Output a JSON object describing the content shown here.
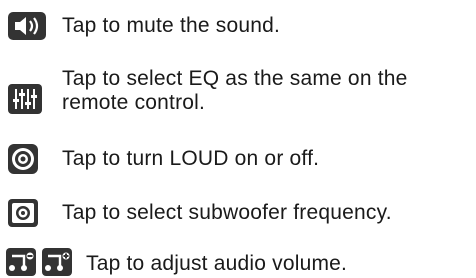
{
  "items": [
    {
      "icon": "speaker-icon",
      "text": "Tap to mute the sound."
    },
    {
      "icon": "equalizer-icon",
      "text_line1": "Tap to select EQ as the same on the",
      "text_line2": "remote control."
    },
    {
      "icon": "loud-icon",
      "text": "Tap to turn LOUD on or off."
    },
    {
      "icon": "subwoofer-icon",
      "text": "Tap to select subwoofer frequency."
    },
    {
      "icon": "volume-down-icon",
      "icon2": "volume-up-icon",
      "text": "Tap to adjust audio volume."
    }
  ],
  "colors": {
    "icon_bg": "#3a3a3a",
    "icon_fg": "#ffffff",
    "text": "#1a1a1a"
  }
}
